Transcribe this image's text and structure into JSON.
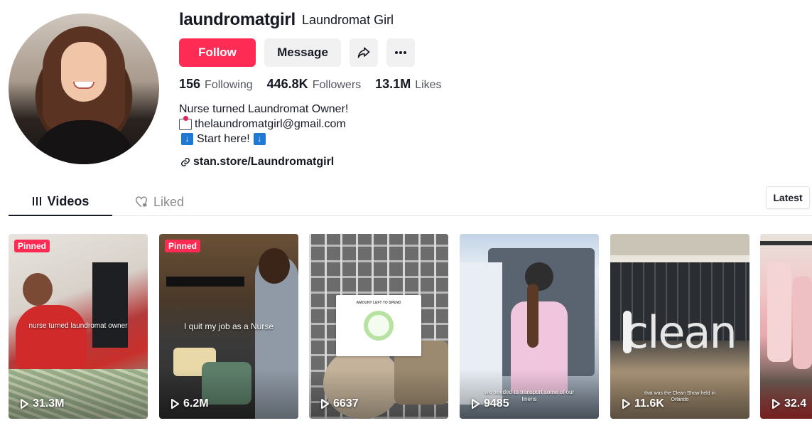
{
  "profile": {
    "username": "laundromatgirl",
    "nickname": "Laundromat Girl",
    "follow_label": "Follow",
    "message_label": "Message",
    "stats": [
      {
        "value": "156",
        "label": "Following"
      },
      {
        "value": "446.8K",
        "label": "Followers"
      },
      {
        "value": "13.1M",
        "label": "Likes"
      }
    ],
    "bio": {
      "line1": "Nurse turned Laundromat Owner!",
      "line2_icon": "envelope-with-heart-icon",
      "line2": "thelaundromatgirl@gmail.com",
      "line3_icon": "down-arrow-icon",
      "line3": "Start here!"
    },
    "link_icon": "link-icon",
    "link": "stan.store/Laundromatgirl"
  },
  "tabs": [
    {
      "label": "Videos",
      "icon": "grid-lines-icon",
      "active": true
    },
    {
      "label": "Liked",
      "icon": "heart-lock-icon",
      "active": false
    }
  ],
  "sort_label": "Latest",
  "colors": {
    "accent": "#fe2c55",
    "button_secondary": "#f1f1f2",
    "text": "#161823",
    "muted": "#545660"
  },
  "videos": [
    {
      "pinned": true,
      "pinned_label": "Pinned",
      "caption": "nurse turned laundromat owner",
      "views": "31.3M"
    },
    {
      "pinned": true,
      "pinned_label": "Pinned",
      "caption": "I quit my job as a Nurse",
      "views": "6.2M"
    },
    {
      "pinned": false,
      "caption": "AMOUNT LEFT TO SPEND",
      "views": "6637"
    },
    {
      "pinned": false,
      "caption": "we needed to transport some of our linens",
      "views": "9485"
    },
    {
      "pinned": false,
      "caption": "that was the Clean Show held in Orlando",
      "overlay_word": "clean",
      "views": "11.6K"
    },
    {
      "pinned": false,
      "caption": "",
      "views": "32.4"
    }
  ]
}
